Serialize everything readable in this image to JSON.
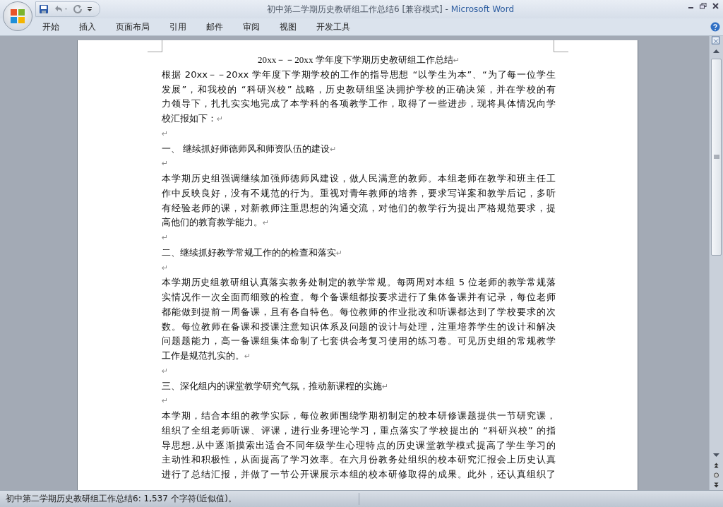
{
  "window": {
    "document_title": "初中第二学期历史教研组工作总结6 [兼容模式] - ",
    "app_name": "Microsoft Word"
  },
  "ribbon_tabs": [
    {
      "label": "开始"
    },
    {
      "label": "插入"
    },
    {
      "label": "页面布局"
    },
    {
      "label": "引用"
    },
    {
      "label": "邮件"
    },
    {
      "label": "审阅"
    },
    {
      "label": "视图"
    },
    {
      "label": "开发工具"
    }
  ],
  "document": {
    "paragraphs": [
      {
        "kind": "title",
        "lines": [
          "20xx－－20xx 学年度下学期历史教研组工作总结"
        ],
        "mark": "↵"
      },
      {
        "kind": "body",
        "lines": [
          "根据 20xx－－20xx 学年度下学期学校的工作的指导思想 “以学生为本”、“为了每一位学生",
          "发展”，和我校的 “科研兴校” 战略，历史教研组坚决拥护学校的正确决策，并在学校的有",
          "力领导下，扎扎实实地完成了本学科的各项教学工作，取得了一些进步，现将具体情况向学",
          "校汇报如下："
        ],
        "mark": "↵"
      },
      {
        "kind": "empty",
        "mark": "↵"
      },
      {
        "kind": "heading",
        "lines": [
          "一、  继续抓好师德师风和师资队伍的建设"
        ],
        "mark": "↵"
      },
      {
        "kind": "empty",
        "mark": "↵"
      },
      {
        "kind": "body",
        "lines": [
          "本学期历史组强调继续加强师德师风建设，做人民满意的教师。本组老师在教学和班主任工",
          "作中反映良好，没有不规范的行为。重视对青年教师的培养，要求写详案和教学后记，多听",
          "有经验老师的课，对新教师注重思想的沟通交流，对他们的教学行为提出严格规范要求，提",
          "高他们的教育教学能力。"
        ],
        "mark": "↵"
      },
      {
        "kind": "empty",
        "mark": "↵"
      },
      {
        "kind": "heading",
        "lines": [
          "二、继续抓好教学常规工作的的检查和落实"
        ],
        "mark": "↵"
      },
      {
        "kind": "empty",
        "mark": "↵"
      },
      {
        "kind": "body",
        "lines": [
          "本学期历史组教研组认真落实教务处制定的教学常规。每两周对本组 5 位老师的教学常规落",
          "实情况作一次全面而细致的检查。每个备课组都按要求进行了集体备课并有记录，每位老师",
          "都能做到提前一周备课，且有各自特色。每位教师的作业批改和听课都达到了学校要求的次",
          "数。每位教师在备课和授课注意知识体系及问题的设计与处理，注重培养学生的设计和解决",
          "问题题能力，高一备课组集体命制了七套供会考复习使用的练习卷。可见历史组的常规教学",
          "工作是规范扎实的。"
        ],
        "mark": "↵"
      },
      {
        "kind": "empty",
        "mark": "↵"
      },
      {
        "kind": "heading",
        "lines": [
          "三、深化组内的课堂教学研究气氛，推动新课程的实施"
        ],
        "mark": "↵"
      },
      {
        "kind": "empty",
        "mark": "↵"
      },
      {
        "kind": "body",
        "lines": [
          "本学期，结合本组的教学实际，每位教师围绕学期初制定的校本研修课题提供一节研究课，",
          "组织了全组老师听课、评课，进行业务理论学习，重点落实了学校提出的 “科研兴校” 的指",
          "导思想,从中逐渐摸索出适合不同年级学生心理特点的历史课堂教学模式提高了学生学习的",
          "主动性和积极性，从面提高了学习效率。在六月份教务处组织的校本研究汇报会上历史认真",
          "进行了总结汇报，并做了一节公开课展示本组的校本研修取得的成果。此外，还认真组织了"
        ]
      }
    ]
  },
  "status_bar": {
    "text": "初中第二学期历史教研组工作总结6: 1,537 个字符(近似值)。"
  }
}
